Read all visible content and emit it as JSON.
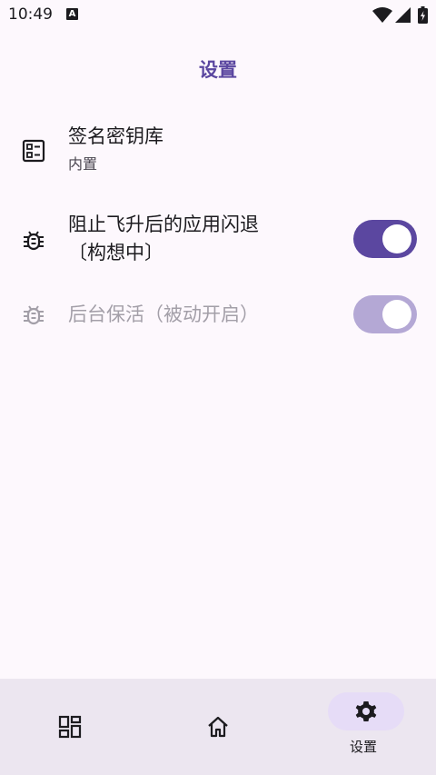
{
  "status": {
    "time": "10:49",
    "notif_glyph": "A",
    "icons": [
      "wifi-icon",
      "signal-icon",
      "battery-icon"
    ]
  },
  "page": {
    "title": "设置"
  },
  "settings": [
    {
      "icon": "keystore-icon",
      "title": "签名密钥库",
      "subtitle": "内置"
    },
    {
      "icon": "bug-icon",
      "title": "阻止飞升后的应用闪退",
      "subtitle": "〔构想中〕",
      "toggle": true
    },
    {
      "icon": "bug-icon",
      "title": "后台保活（被动开启）",
      "toggle": true,
      "disabled": true
    }
  ],
  "nav": {
    "items": [
      {
        "icon": "dashboard-icon"
      },
      {
        "icon": "home-icon"
      },
      {
        "icon": "gear-icon",
        "label": "设置",
        "selected": true
      }
    ]
  },
  "colors": {
    "accent": "#5b47a0",
    "accent_disabled": "#b4a8d5",
    "nav_bg": "#ece6f0",
    "bg": "#fdf8fd"
  }
}
